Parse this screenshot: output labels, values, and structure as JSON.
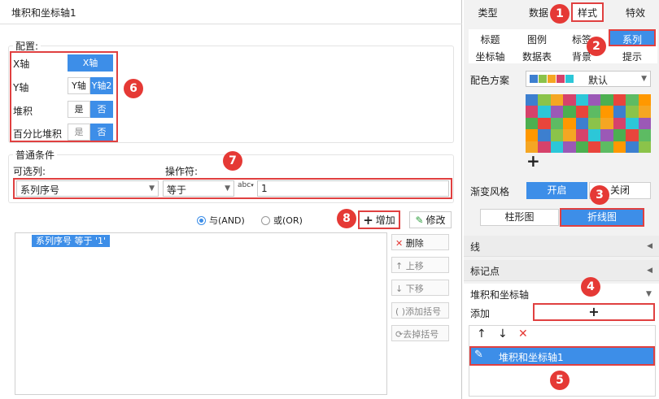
{
  "dialog": {
    "title": "堆积和坐标轴1",
    "config_legend": "配置:",
    "rows": [
      {
        "label": "X轴",
        "options": [
          "X轴"
        ]
      },
      {
        "label": "Y轴",
        "options": [
          "Y轴",
          "Y轴2"
        ]
      },
      {
        "label": "堆积",
        "options": [
          "是",
          "否"
        ]
      },
      {
        "label": "百分比堆积",
        "options": [
          "是",
          "否"
        ]
      }
    ],
    "condition_legend": "普通条件",
    "optional_col_label": "可选列:",
    "operator_label": "操作符:",
    "column_value": "系列序号",
    "operator_value": "等于",
    "value_input": "1",
    "radio_and": "与(AND)",
    "radio_or": "或(OR)",
    "add_button": "增加",
    "modify_button": "修改",
    "condition_item": "系列序号 等于 '1'",
    "side_buttons": [
      "删除",
      "上移",
      "下移",
      "添加括号",
      "去掉括号"
    ]
  },
  "panel": {
    "tabs": [
      "类型",
      "数据",
      "样式",
      "特效"
    ],
    "subtabs_row1": [
      "标题",
      "图例",
      "标签",
      "系列"
    ],
    "subtabs_row2": [
      "坐标轴",
      "数据表",
      "背景",
      "提示"
    ],
    "palette_label": "配色方案",
    "palette_value": "默认",
    "gradient_label": "渐变风格",
    "gradient_on": "开启",
    "gradient_off": "关闭",
    "bar_chart": "柱形图",
    "line_chart": "折线图",
    "sections": [
      "线",
      "标记点",
      "堆积和坐标轴"
    ],
    "add_label": "添加",
    "list_item": "堆积和坐标轴1"
  },
  "badges": [
    "1",
    "2",
    "3",
    "4",
    "5",
    "6",
    "7",
    "8"
  ],
  "colors": {
    "accent": "#3d8ee8",
    "highlight_red": "#e04040",
    "badge_red": "#e53935",
    "grid_colors": [
      "#3d7fcf",
      "#8bc34a",
      "#f5a623",
      "#d6426b",
      "#2cc7d8",
      "#9b59b6",
      "#4caf50",
      "#e8453c",
      "#5dbb63",
      "#ff9800"
    ]
  }
}
